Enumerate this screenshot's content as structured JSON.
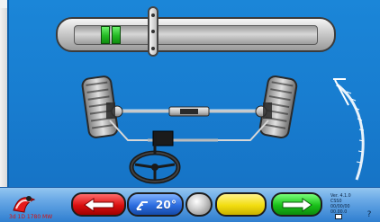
{
  "bottom_bar": {
    "logo_text": "3d 1D 1780 MW",
    "angle_button": {
      "value": "20°"
    },
    "info_lines": [
      "Ver. 4.1.0",
      "CSS0",
      "00/00/00",
      "00.00.0"
    ],
    "help_symbol": "?"
  },
  "icons": {
    "back": "left-arrow-icon",
    "angle": "steering-angle-icon",
    "neutral": "round-neutral-button",
    "confirm": "yellow-blank-button",
    "next": "right-arrow-icon",
    "help": "help-icon"
  },
  "colors": {
    "screen": "#1b86d8",
    "green_band": "#23b923",
    "red_button": "#d90f0f",
    "blue_button": "#2c6de0",
    "yellow_button": "#f2dd10",
    "green_button": "#18c018"
  }
}
